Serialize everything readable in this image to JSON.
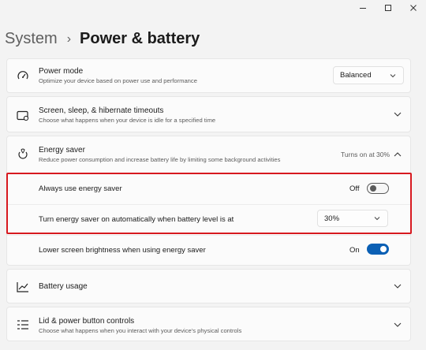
{
  "window": {
    "minimize_icon": "minimize-icon",
    "maximize_icon": "maximize-icon",
    "close_icon": "close-icon"
  },
  "breadcrumb": {
    "root": "System",
    "separator": "›",
    "current": "Power & battery"
  },
  "power_mode": {
    "title": "Power mode",
    "description": "Optimize your device based on power use and performance",
    "value": "Balanced",
    "icon": "power-mode-icon"
  },
  "screen_sleep": {
    "title": "Screen, sleep, & hibernate timeouts",
    "description": "Choose what happens when your device is idle for a specified time",
    "icon": "screen-sleep-icon"
  },
  "energy_saver": {
    "title": "Energy saver",
    "description": "Reduce power consumption and increase battery life by limiting some background activities",
    "status": "Turns on at 30%",
    "icon": "energy-saver-icon",
    "always_use": {
      "label": "Always use energy saver",
      "state_label": "Off",
      "enabled": false
    },
    "auto_on": {
      "label": "Turn energy saver on automatically when battery level is at",
      "value": "30%"
    },
    "lower_brightness": {
      "label": "Lower screen brightness when using energy saver",
      "state_label": "On",
      "enabled": true
    }
  },
  "battery_usage": {
    "title": "Battery usage",
    "icon": "battery-usage-icon"
  },
  "lid_power": {
    "title": "Lid & power button controls",
    "description": "Choose what happens when you interact with your device's physical controls",
    "icon": "lid-power-icon"
  },
  "colors": {
    "accent": "#0a5fb4",
    "highlight": "#d7191f"
  }
}
